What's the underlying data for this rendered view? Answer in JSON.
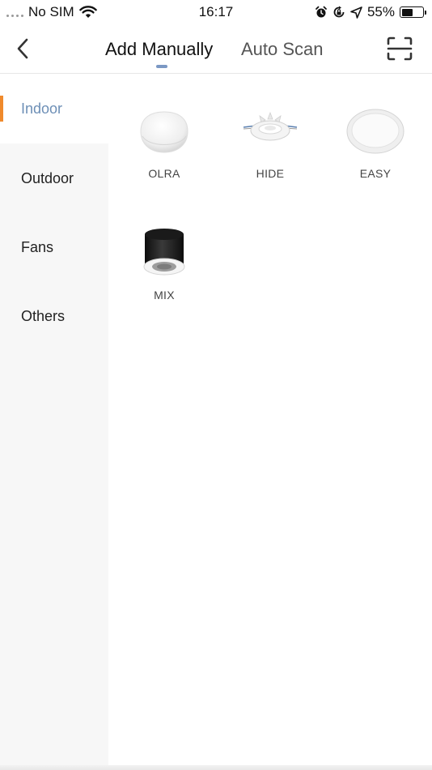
{
  "status_bar": {
    "carrier": "No SIM",
    "time": "16:17",
    "battery_percent": "55%",
    "battery_level": 0.55
  },
  "header": {
    "tabs": [
      {
        "label": "Add Manually",
        "active": true
      },
      {
        "label": "Auto Scan",
        "active": false
      }
    ],
    "accent_color": "#7b98c4"
  },
  "sidebar": {
    "active_color": "#6d8fb6",
    "marker_color": "#f08a2c",
    "items": [
      {
        "label": "Indoor",
        "active": true
      },
      {
        "label": "Outdoor",
        "active": false
      },
      {
        "label": "Fans",
        "active": false
      },
      {
        "label": "Others",
        "active": false
      }
    ]
  },
  "devices": [
    {
      "label": "OLRA",
      "icon": "surface-light-icon"
    },
    {
      "label": "HIDE",
      "icon": "recessed-downlight-icon"
    },
    {
      "label": "EASY",
      "icon": "flat-panel-light-icon"
    },
    {
      "label": "MIX",
      "icon": "cylinder-spotlight-icon"
    }
  ]
}
